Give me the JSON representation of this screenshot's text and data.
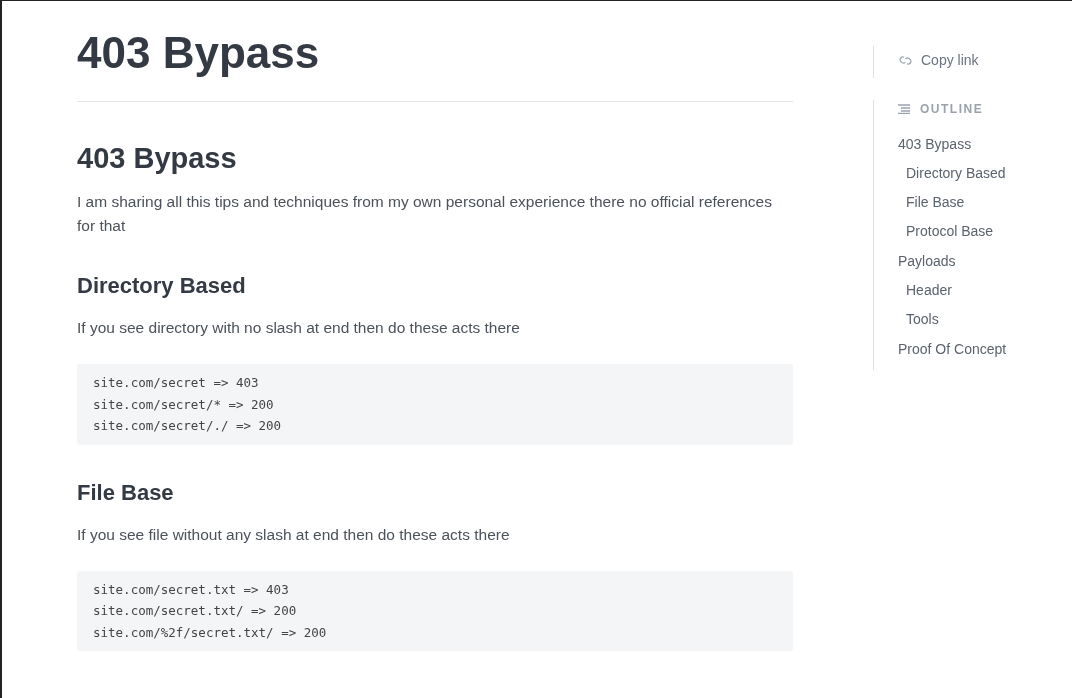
{
  "page_title": "403 Bypass",
  "blocks": [
    {
      "kind": "h2",
      "text": "403 Bypass"
    },
    {
      "kind": "p",
      "text": "I am sharing all this tips and techniques from my own personal experience there no official references for that"
    },
    {
      "kind": "h3",
      "text": "Directory Based"
    },
    {
      "kind": "p",
      "text": "If you see directory with no slash at end then do these acts there"
    },
    {
      "kind": "code",
      "lines": [
        "site.com/secret => 403",
        "site.com/secret/* => 200",
        "site.com/secret/./ => 200"
      ]
    },
    {
      "kind": "h3",
      "text": "File Base"
    },
    {
      "kind": "p",
      "text": "If you see file without any slash at end then do these acts there"
    },
    {
      "kind": "code",
      "lines": [
        "site.com/secret.txt => 403",
        "site.com/secret.txt/ => 200",
        "site.com/%2f/secret.txt/ => 200"
      ]
    }
  ],
  "sidebar": {
    "copy_link": "Copy link",
    "outline_title": "OUTLINE",
    "outline": [
      {
        "label": "403 Bypass",
        "children": [
          {
            "label": "Directory Based"
          },
          {
            "label": "File Base"
          },
          {
            "label": "Protocol Base"
          }
        ]
      },
      {
        "label": "Payloads",
        "children": [
          {
            "label": "Header"
          },
          {
            "label": "Tools"
          }
        ]
      },
      {
        "label": "Proof Of Concept"
      }
    ]
  }
}
